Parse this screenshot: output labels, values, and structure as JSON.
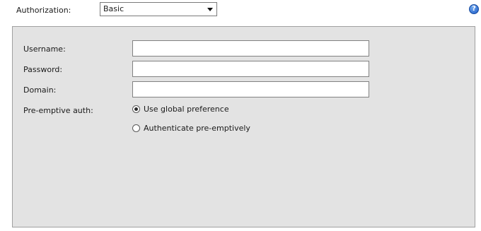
{
  "authorization": {
    "label": "Authorization:",
    "selected": "Basic"
  },
  "help_icon": {
    "glyph": "?"
  },
  "form": {
    "username_label": "Username:",
    "password_label": "Password:",
    "domain_label": "Domain:",
    "preemptive_label": "Pre-emptive auth:",
    "username_value": "",
    "password_value": "",
    "domain_value": "",
    "options": [
      {
        "label": "Use global preference",
        "checked": true
      },
      {
        "label": "Authenticate pre-emptively",
        "checked": false
      }
    ]
  }
}
